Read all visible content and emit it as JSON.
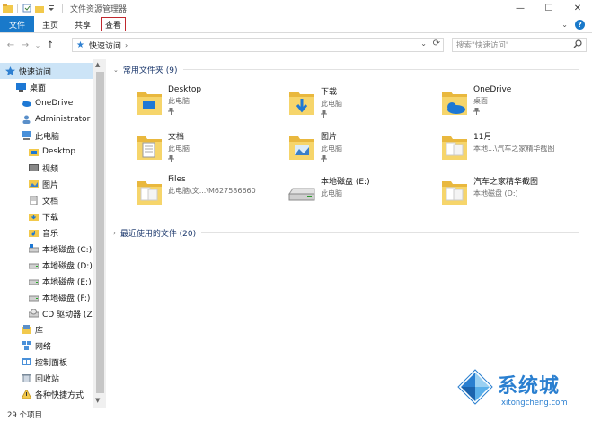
{
  "window": {
    "title": "文件资源管理器",
    "controls": {
      "minimize": "—",
      "maximize": "☐",
      "close": "✕"
    }
  },
  "ribbon": {
    "tabs": [
      {
        "label": "文件",
        "active": true
      },
      {
        "label": "主页"
      },
      {
        "label": "共享"
      },
      {
        "label": "查看",
        "highlighted": true
      }
    ],
    "expand": "⌄",
    "help": "?"
  },
  "address": {
    "back": "←",
    "forward": "→",
    "recent": "⌄",
    "up": "↑",
    "breadcrumb": "快速访问",
    "chevron": "›",
    "dropdown": "⌄",
    "refresh": "⟳"
  },
  "search": {
    "placeholder": "搜索\"快速访问\"",
    "icon": "search-icon"
  },
  "nav": {
    "items": [
      {
        "label": "快速访问",
        "icon": "star-icon",
        "selected": true
      },
      {
        "label": "桌面",
        "icon": "desktop-icon"
      },
      {
        "label": "OneDrive",
        "icon": "cloud-icon"
      },
      {
        "label": "Administrator",
        "icon": "user-icon"
      },
      {
        "label": "此电脑",
        "icon": "computer-icon"
      },
      {
        "label": "Desktop",
        "icon": "desktop-folder-icon"
      },
      {
        "label": "视频",
        "icon": "video-icon"
      },
      {
        "label": "图片",
        "icon": "pictures-icon"
      },
      {
        "label": "文档",
        "icon": "documents-icon"
      },
      {
        "label": "下载",
        "icon": "download-icon"
      },
      {
        "label": "音乐",
        "icon": "music-icon"
      },
      {
        "label": "本地磁盘 (C:)",
        "icon": "drive-c-icon"
      },
      {
        "label": "本地磁盘 (D:)",
        "icon": "drive-icon"
      },
      {
        "label": "本地磁盘 (E:)",
        "icon": "drive-icon"
      },
      {
        "label": "本地磁盘 (F:)",
        "icon": "drive-icon"
      },
      {
        "label": "CD 驱动器 (Z:)",
        "icon": "cd-icon"
      },
      {
        "label": "库",
        "icon": "library-icon"
      },
      {
        "label": "网络",
        "icon": "network-icon"
      },
      {
        "label": "控制面板",
        "icon": "control-panel-icon"
      },
      {
        "label": "回收站",
        "icon": "recycle-bin-icon"
      },
      {
        "label": "各种快捷方式",
        "icon": "shortcut-icon"
      }
    ]
  },
  "groups": {
    "frequent": {
      "label": "常用文件夹 (9)",
      "chevron": "⌄"
    },
    "recent": {
      "label": "最近使用的文件 (20)",
      "chevron": "›"
    }
  },
  "folders": [
    {
      "name": "Desktop",
      "sub": "此电脑",
      "pinned": true,
      "icon": "desktop-folder-icon"
    },
    {
      "name": "下载",
      "sub": "此电脑",
      "pinned": true,
      "icon": "download-folder-icon"
    },
    {
      "name": "OneDrive",
      "sub": "桌面",
      "pinned": true,
      "icon": "onedrive-folder-icon"
    },
    {
      "name": "文档",
      "sub": "此电脑",
      "pinned": true,
      "icon": "documents-folder-icon"
    },
    {
      "name": "图片",
      "sub": "此电脑",
      "pinned": true,
      "icon": "pictures-folder-icon"
    },
    {
      "name": "11月",
      "sub": "本地...\\汽车之家精华截图",
      "pinned": false,
      "icon": "folder-icon"
    },
    {
      "name": "Files",
      "sub": "此电脑\\文...\\M627586660",
      "pinned": false,
      "icon": "folder-icon"
    },
    {
      "name": "本地磁盘 (E:)",
      "sub": "此电脑",
      "pinned": false,
      "icon": "drive-icon"
    },
    {
      "name": "汽车之家精华截图",
      "sub": "本地磁盘 (D:)",
      "pinned": false,
      "icon": "folder-icon"
    }
  ],
  "pin_glyph": "📌",
  "status": {
    "count": "29 个项目"
  },
  "watermark": {
    "text": "系统城",
    "url": "xitongcheng.com"
  },
  "colors": {
    "accent": "#1979ca",
    "selected": "#cce4f7",
    "folder": "#f2c94c",
    "highlight_border": "#c0282e"
  }
}
